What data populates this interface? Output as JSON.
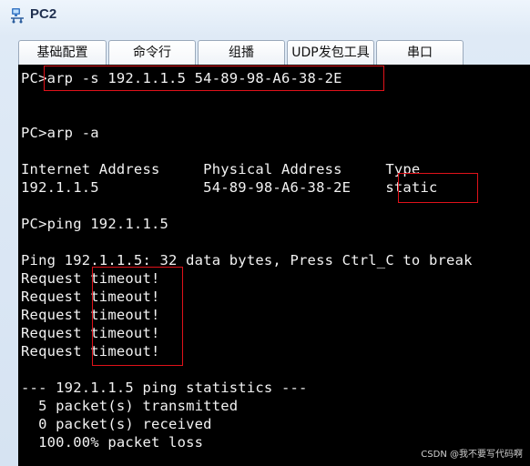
{
  "window": {
    "title": "PC2",
    "icon": "pc-network-icon"
  },
  "tabs": [
    {
      "label": "基础配置"
    },
    {
      "label": "命令行"
    },
    {
      "label": "组播"
    },
    {
      "label": "UDP发包工具"
    },
    {
      "label": "串口"
    }
  ],
  "terminal": {
    "lines": [
      "PC>arp -s 192.1.1.5 54-89-98-A6-38-2E",
      "",
      "",
      "PC>arp -a",
      "",
      "Internet Address     Physical Address     Type",
      "192.1.1.5            54-89-98-A6-38-2E    static",
      "",
      "PC>ping 192.1.1.5",
      "",
      "Ping 192.1.1.5: 32 data bytes, Press Ctrl_C to break",
      "Request timeout!",
      "Request timeout!",
      "Request timeout!",
      "Request timeout!",
      "Request timeout!",
      "",
      "--- 192.1.1.5 ping statistics ---",
      "  5 packet(s) transmitted",
      "  0 packet(s) received",
      "  100.00% packet loss"
    ]
  },
  "watermark": "CSDN @我不要写代码啊",
  "colors": {
    "highlight_box": "#e0121a",
    "terminal_bg": "#000000",
    "terminal_fg": "#f2f2f2"
  }
}
